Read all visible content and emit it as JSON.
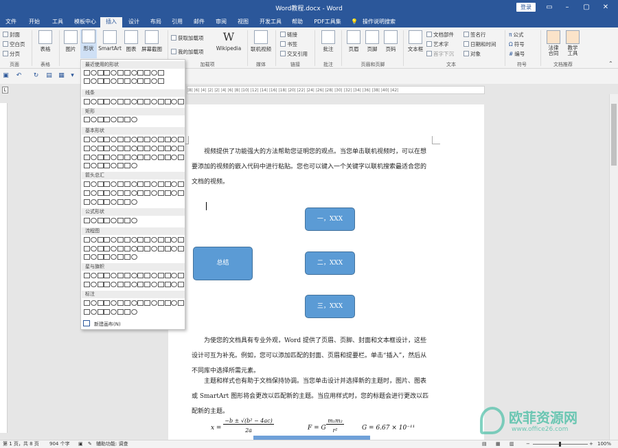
{
  "window": {
    "title": "Word教程.docx - Word",
    "login": "登录",
    "controls": [
      "▭",
      "–",
      "▢",
      "✕"
    ]
  },
  "tabs": [
    "文件",
    "开始",
    "工具",
    "模板中心",
    "插入",
    "设计",
    "布局",
    "引用",
    "邮件",
    "审阅",
    "视图",
    "开发工具",
    "帮助",
    "PDF工具集",
    "操作说明搜索"
  ],
  "ribbon": {
    "pages": [
      "封面",
      "空白页",
      "分页"
    ],
    "table": "表格",
    "pic": "图片",
    "shapes": "形状",
    "smartart": "SmartArt",
    "chart": "图表",
    "screenshot": "屏幕截图",
    "addins": [
      "获取加载项",
      "我的加载项"
    ],
    "wikipedia": "Wikipedia",
    "video": "联机视频",
    "links": [
      "链接",
      "书签",
      "交叉引用"
    ],
    "comment": "批注",
    "header": "页眉",
    "footer": "页脚",
    "pagenum": "页码",
    "textbox": "文本框",
    "docparts": "文档部件",
    "wordart": "艺术字",
    "dropcap": "首字下沉",
    "sigline": "签名行",
    "datetime": "日期和时间",
    "object": "对象",
    "equation": "公式",
    "symbol": "符号",
    "number": "编号",
    "law": "法律\n合同",
    "edu": "教学\n工具",
    "groups": [
      "页面",
      "表格",
      "加载项",
      "媒体",
      "链接",
      "批注",
      "页眉和页脚",
      "文本",
      "符号",
      "文档推荐"
    ]
  },
  "ruler": "|8| |6| |4| |2|   |2| |4| |6| |8| |10| |12| |14| |16| |18| |20| |22| |24| |26| |28| |30| |32| |34| |36| |38| |40| |42|",
  "shapes_menu": {
    "sections": [
      "最近使用的形状",
      "线条",
      "矩形",
      "基本形状",
      "箭头总汇",
      "公式形状",
      "流程图",
      "星与旗帜",
      "标注"
    ],
    "new_canvas": "新建画布(N)"
  },
  "document": {
    "p1": "视频提供了功能强大的方法帮助您证明您的观点。当您单击联机视频时，可以在想要添加的视频的嵌入代码中进行粘贴。您也可以键入一个关键字以联机搜索最适合您的文档的视频。",
    "boxes": [
      "总结",
      "一，XXX",
      "二，XXX",
      "三，XXX"
    ],
    "p2": "为使您的文档具有专业外观，Word 提供了页眉、页脚、封面和文本框设计，这些设计可互为补充。例如，您可以添加匹配的封面、页眉和提要栏。单击“插入”，然后从不同库中选择所需元素。",
    "p3": "主题和样式也有助于文档保持协调。当您单击设计并选择新的主题时，图片、图表或 SmartArt 图形将会更改以匹配新的主题。当应用样式时，您的标题会进行更改以匹配新的主题。",
    "eq1_lhs": "x =",
    "eq1_num": "−b ± √(b² − 4ac)",
    "eq1_den": "2a",
    "eq2_lhs": "F = G",
    "eq2_num": "m₁m₂",
    "eq2_den": "r²",
    "eq3": "G = 6.67 × 10⁻¹¹"
  },
  "status": {
    "page": "第 1 页，共 8 页",
    "words": "904 个字",
    "access": "辅助功能: 调查",
    "zoom": "100%"
  },
  "watermark": {
    "main": "欧菲资源网",
    "sub": "www.office26.com"
  }
}
